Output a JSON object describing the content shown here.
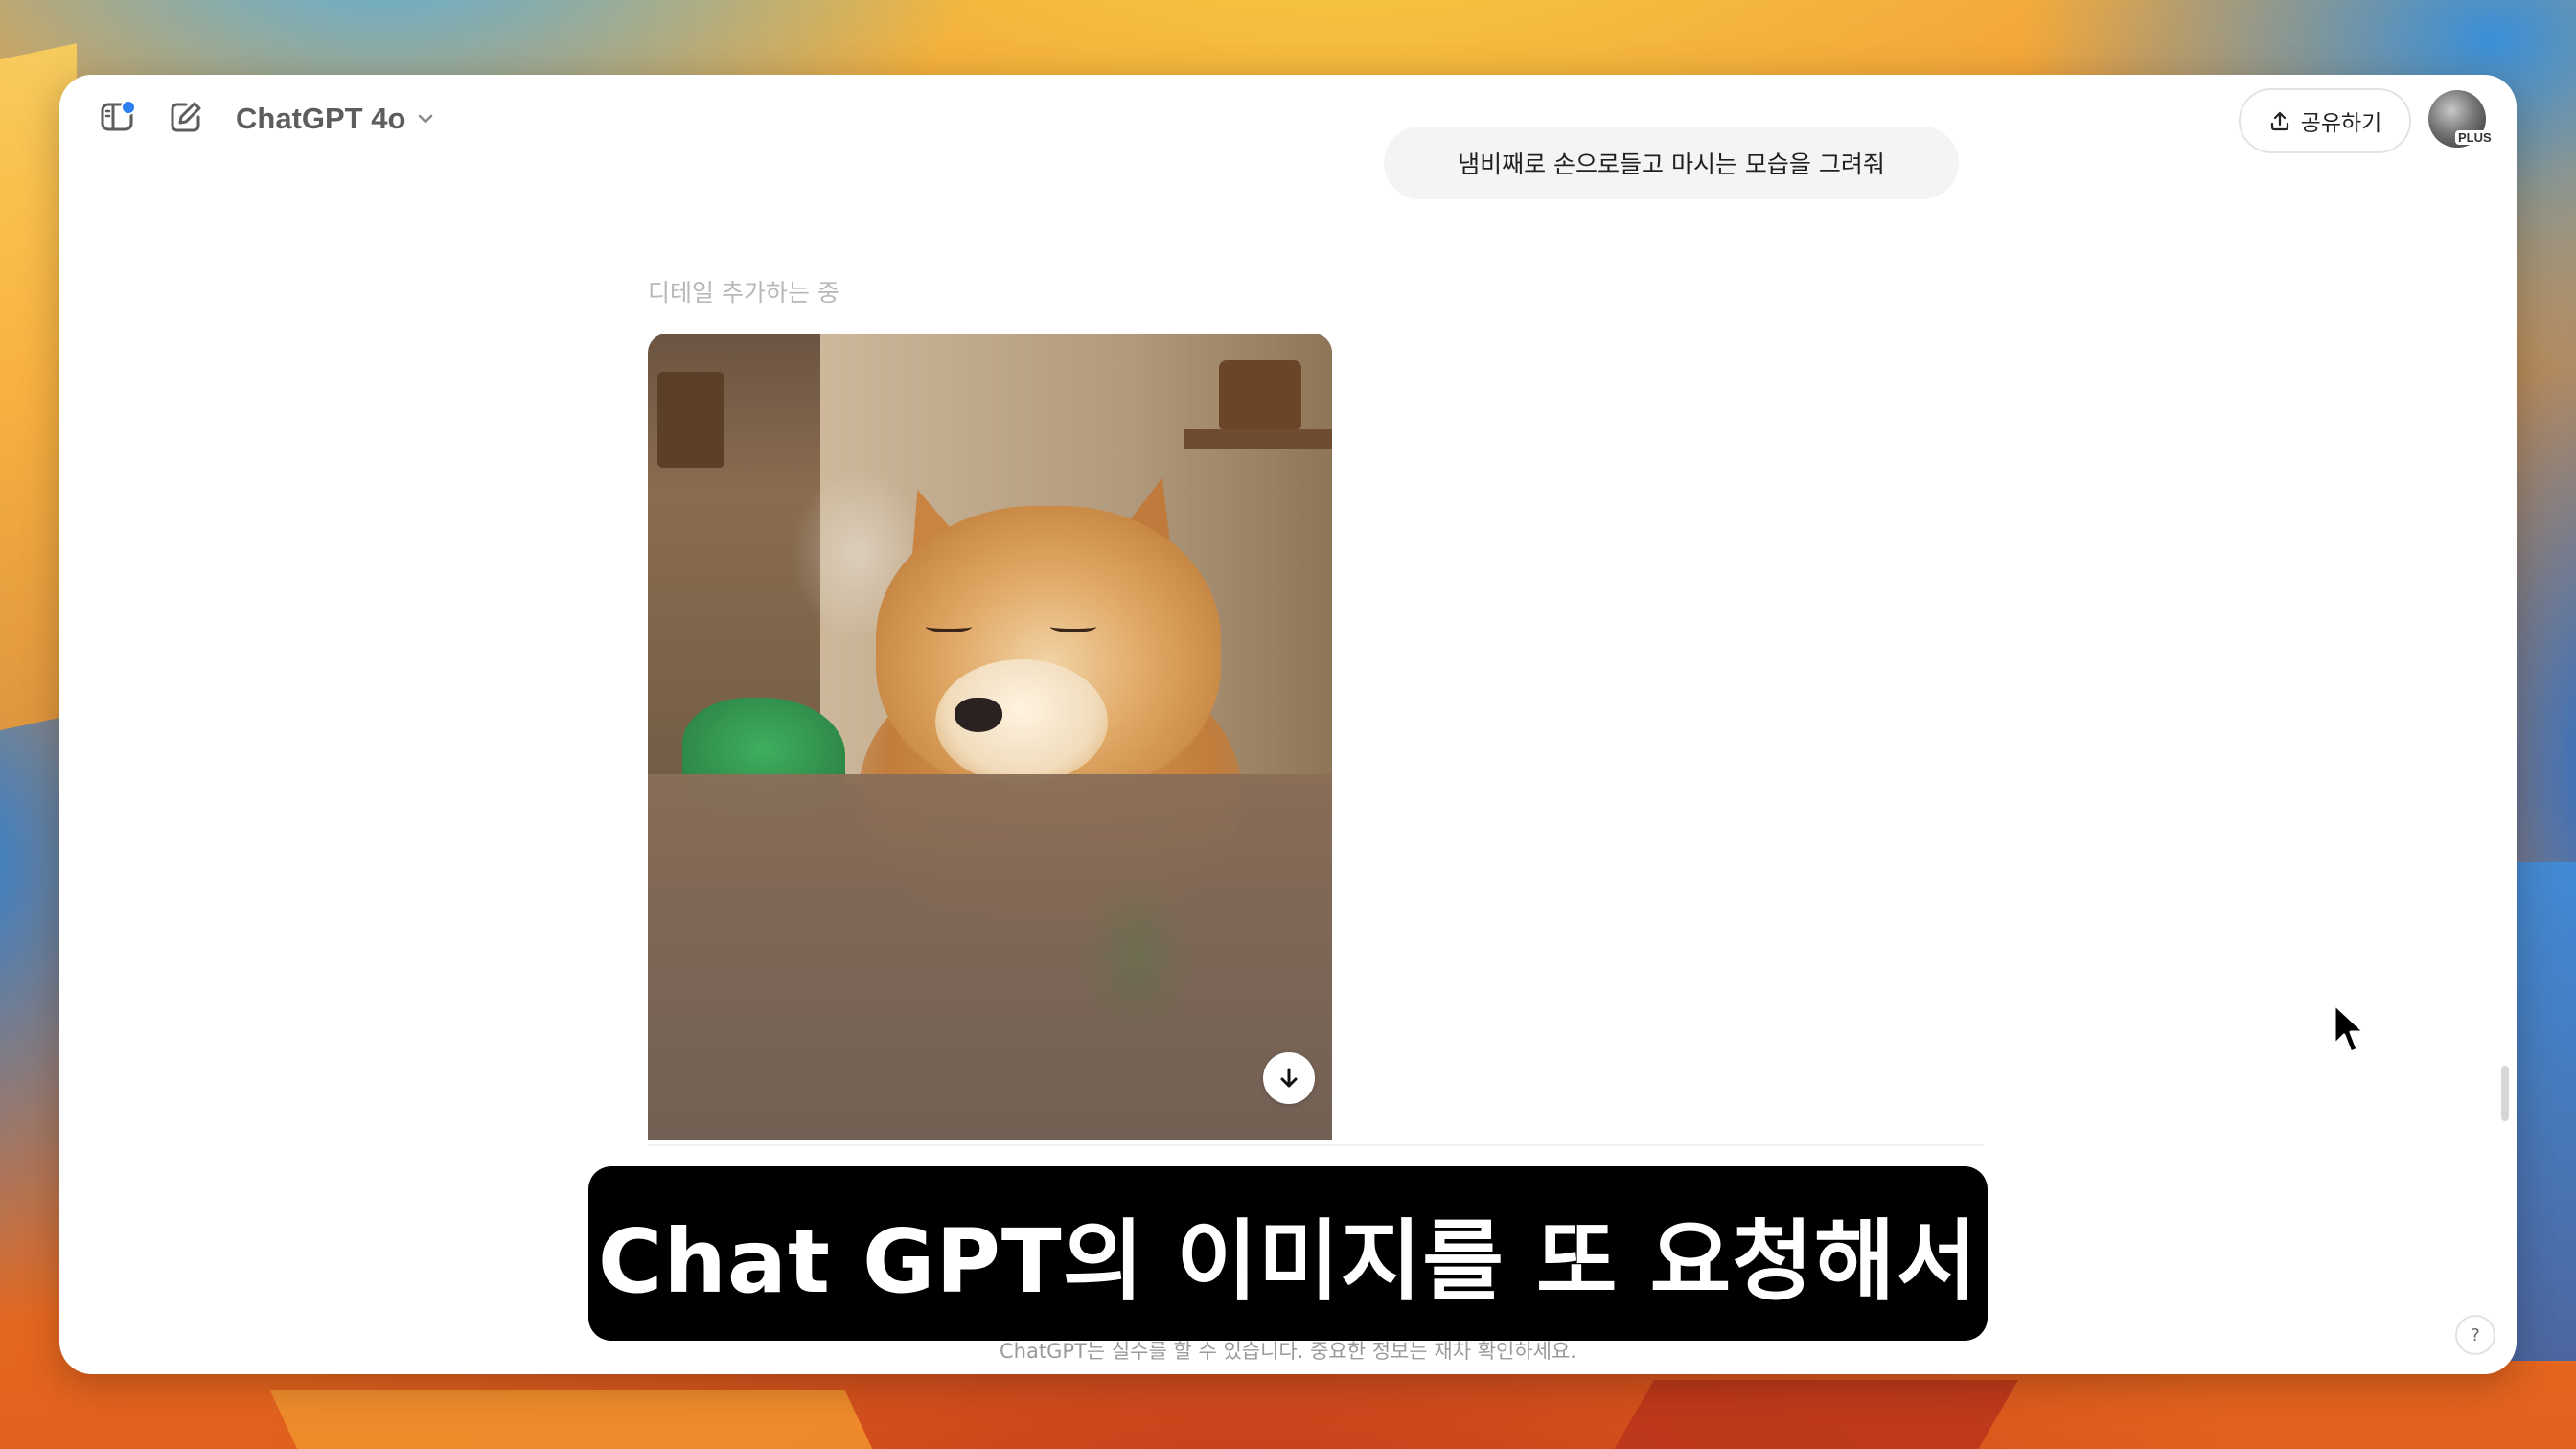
{
  "header": {
    "model_name": "ChatGPT 4o",
    "share_label": "공유하기",
    "plan_badge": "PLUS"
  },
  "conversation": {
    "user_message": "냄비째로 손으로들고 마시는 모습을 그려줘",
    "assistant_status": "디테일 추가하는 중",
    "image_alt": "shiba-inu-drinking-image"
  },
  "footer": {
    "disclaimer": "ChatGPT는 실수를 할 수 있습니다. 중요한 정보는 재차 확인하세요.",
    "help_label": "?"
  },
  "overlay": {
    "subtitle": "Chat GPT의 이미지를 또 요청해서"
  },
  "colors": {
    "accent_dot": "#2b7ff0",
    "window_bg": "#ffffff",
    "bubble_bg": "#f4f4f4"
  }
}
